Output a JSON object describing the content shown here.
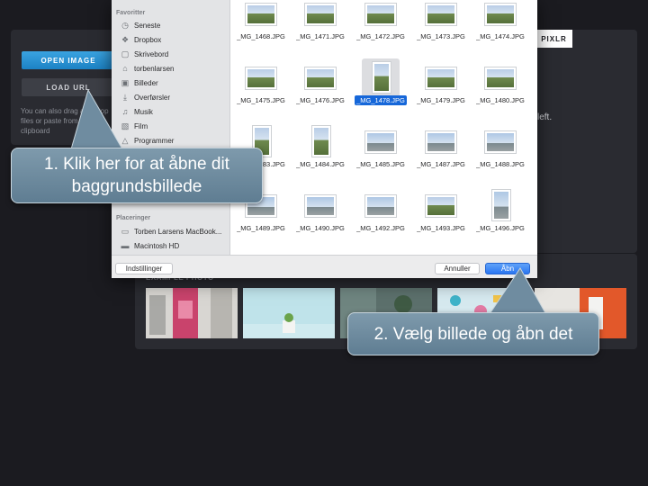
{
  "pixlr": {
    "open_image_label": "OPEN IMAGE",
    "load_label": "LOAD URL",
    "hint_text": "You can also drag and drop files or paste from the clipboard",
    "logo": "PIXLR",
    "right_text": "left.",
    "example_label": "EXAMPLE PHOTO"
  },
  "dialog": {
    "sidebar": {
      "favorites_heading": "Favoritter",
      "favorites": [
        {
          "label": "Seneste",
          "icon": "clock-icon"
        },
        {
          "label": "Dropbox",
          "icon": "dropbox-icon"
        },
        {
          "label": "Skrivebord",
          "icon": "desktop-icon"
        },
        {
          "label": "torbenlarsen",
          "icon": "home-icon"
        },
        {
          "label": "Billeder",
          "icon": "photos-icon"
        },
        {
          "label": "Overførsler",
          "icon": "download-icon"
        },
        {
          "label": "Musik",
          "icon": "music-icon"
        },
        {
          "label": "Film",
          "icon": "film-icon"
        },
        {
          "label": "Programmer",
          "icon": "apps-icon"
        }
      ],
      "places_heading": "Placeringer",
      "places": [
        {
          "label": "Torben Larsens MacBook...",
          "icon": "laptop-icon"
        },
        {
          "label": "Macintosh HD",
          "icon": "disk-icon"
        }
      ]
    },
    "files": [
      {
        "name": "_MG_1468.JPG",
        "kind": "landscape"
      },
      {
        "name": "_MG_1471.JPG",
        "kind": "landscape"
      },
      {
        "name": "_MG_1472.JPG",
        "kind": "landscape"
      },
      {
        "name": "_MG_1473.JPG",
        "kind": "landscape"
      },
      {
        "name": "_MG_1474.JPG",
        "kind": "landscape"
      },
      {
        "name": "_MG_1475.JPG",
        "kind": "landscape"
      },
      {
        "name": "_MG_1476.JPG",
        "kind": "landscape"
      },
      {
        "name": "_MG_1478.JPG",
        "kind": "portrait",
        "selected": true
      },
      {
        "name": "_MG_1479.JPG",
        "kind": "landscape"
      },
      {
        "name": "_MG_1480.JPG",
        "kind": "landscape"
      },
      {
        "name": "_MG_1483.JPG",
        "kind": "portrait"
      },
      {
        "name": "_MG_1484.JPG",
        "kind": "portrait"
      },
      {
        "name": "_MG_1485.JPG",
        "kind": "sea"
      },
      {
        "name": "_MG_1487.JPG",
        "kind": "sea"
      },
      {
        "name": "_MG_1488.JPG",
        "kind": "sea"
      },
      {
        "name": "_MG_1489.JPG",
        "kind": "sea"
      },
      {
        "name": "_MG_1490.JPG",
        "kind": "sea"
      },
      {
        "name": "_MG_1492.JPG",
        "kind": "sea"
      },
      {
        "name": "_MG_1493.JPG",
        "kind": "landscape"
      },
      {
        "name": "_MG_1496.JPG",
        "kind": "portrait-sea"
      }
    ],
    "options_label": "Indstillinger",
    "cancel_label": "Annuller",
    "open_label": "Åbn"
  },
  "callouts": {
    "step1_line1": "1. Klik her for at åbne dit",
    "step1_line2": "baggrundsbillede",
    "step2": "2. Vælg billede og åbn det"
  },
  "colors": {
    "accent_blue": "#1c82c4",
    "selection_blue": "#1667d9",
    "callout": "#6f8ca0"
  }
}
